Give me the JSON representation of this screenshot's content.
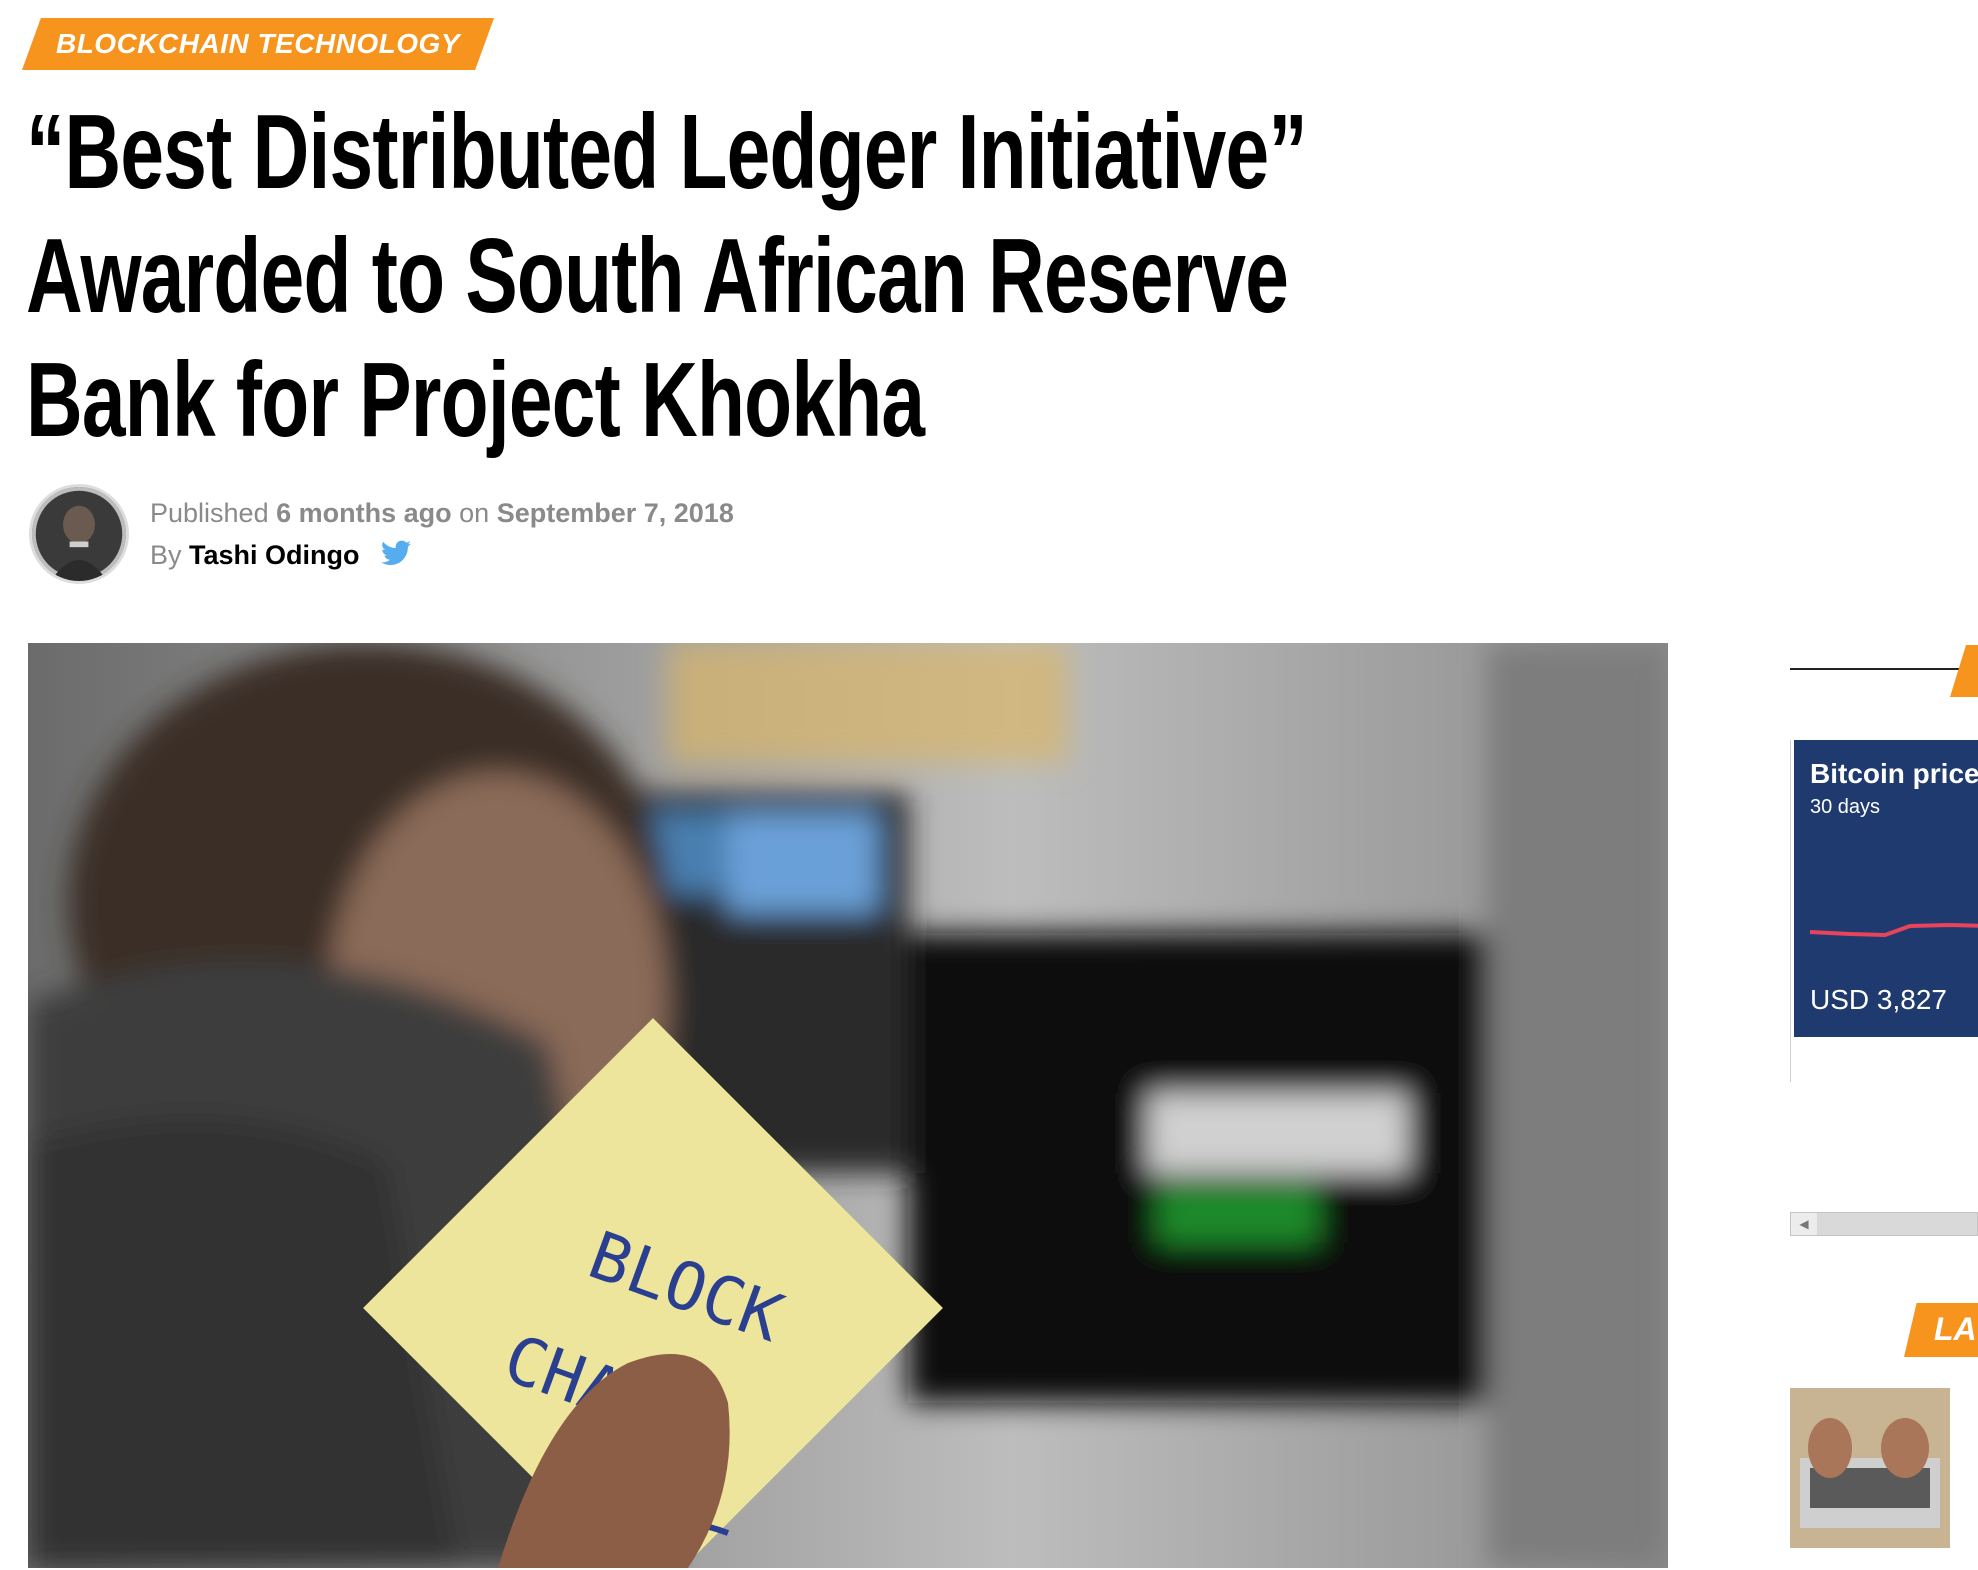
{
  "category": {
    "label": "BLOCKCHAIN TECHNOLOGY",
    "color": "#f7941d"
  },
  "headline": "“Best Distributed Ledger Initiative” Awarded to South African Reserve Bank for Project Khokha",
  "meta": {
    "published_prefix": "Published",
    "relative_time": "6 months ago",
    "on_word": "on",
    "date": "September 7, 2018",
    "by_prefix": "By",
    "author": "Tashi Odingo",
    "social_icon": "twitter-icon"
  },
  "hero": {
    "note_line1": "BLOCK",
    "note_line2": "CHAIN"
  },
  "sidebar": {
    "widget": {
      "title": "Bitcoin price",
      "subtitle": "30 days",
      "price": "USD 3,827",
      "background": "#1f3a6e",
      "line_color": "#e8435a"
    },
    "section_label": "LA"
  }
}
